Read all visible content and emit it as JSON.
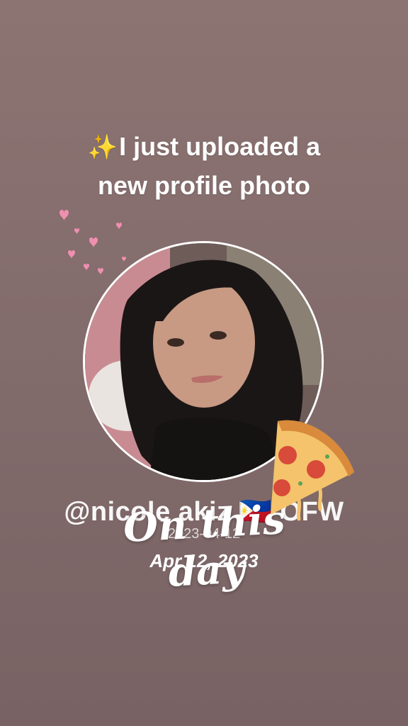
{
  "story": {
    "headline_line1": "I just uploaded a",
    "headline_line2": "new profile photo",
    "sparkle_icon": "✨",
    "handle": "@nicole akiz 🇵🇭 OFW",
    "handle_date": "2023-04-12",
    "sticker_text": "On this day",
    "sticker_date": "Apr 12, 2023"
  },
  "colors": {
    "background_top": "#8c7472",
    "background_bottom": "#786263",
    "heart": "#f08fb0",
    "sparkle": "#f6c443"
  },
  "icons": [
    "sparkles-icon",
    "heart-icon",
    "philippines-flag-icon",
    "pizza-icon"
  ]
}
